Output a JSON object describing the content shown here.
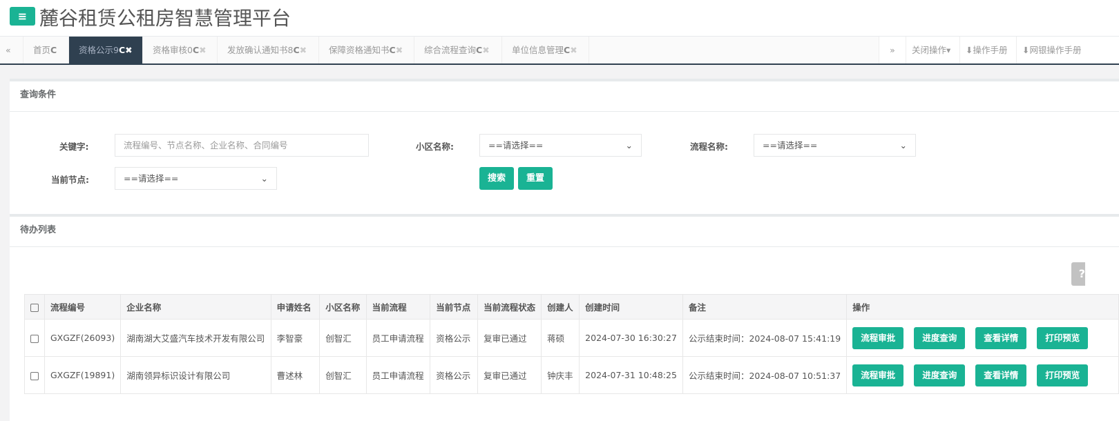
{
  "header": {
    "menu_icon": "bars-icon",
    "title": "麓谷租赁公租房智慧管理平台"
  },
  "tabs": [
    {
      "label": "首页",
      "closable": false
    },
    {
      "label": "资格公示9",
      "closable": true,
      "active": true
    },
    {
      "label": "资格审核0",
      "closable": true
    },
    {
      "label": "发放确认通知书8",
      "closable": true
    },
    {
      "label": "保障资格通知书",
      "closable": true
    },
    {
      "label": "综合流程查询",
      "closable": true
    },
    {
      "label": "单位信息管理",
      "closable": true
    }
  ],
  "tab_tools": {
    "prev": "«",
    "next": "»",
    "close_ops": "关闭操作",
    "manual": "操作手册",
    "bank_manual": "网银操作手册"
  },
  "query": {
    "title": "查询条件",
    "keyword_label": "关键字:",
    "keyword_placeholder": "流程编号、节点名称、企业名称、合同编号",
    "community_label": "小区名称:",
    "community_value": "==请选择==",
    "flow_label": "流程名称:",
    "flow_value": "==请选择==",
    "node_label": "当前节点:",
    "node_value": "==请选择==",
    "search": "搜索",
    "reset": "重置"
  },
  "list": {
    "title": "待办列表",
    "help": "?",
    "columns": [
      "流程编号",
      "企业名称",
      "申请姓名",
      "小区名称",
      "当前流程",
      "当前节点",
      "当前流程状态",
      "创建人",
      "创建时间",
      "备注",
      "操作"
    ],
    "rows": [
      [
        "GXGZF(26093)",
        "湖南湖大艾盛汽车技术开发有限公司",
        "李智豪",
        "创智汇",
        "员工申请流程",
        "资格公示",
        "复审已通过",
        "蒋硕",
        "2024-07-30 16:30:27",
        "公示结束时间：2024-08-07 15:41:19"
      ],
      [
        "GXGZF(19891)",
        "湖南领异标识设计有限公司",
        "曹述林",
        "创智汇",
        "员工申请流程",
        "资格公示",
        "复审已通过",
        "钟庆丰",
        "2024-07-31 10:48:25",
        "公示结束时间：2024-08-07 10:51:37"
      ]
    ],
    "actions": [
      "流程审批",
      "进度查询",
      "查看详情",
      "打印预览"
    ]
  }
}
